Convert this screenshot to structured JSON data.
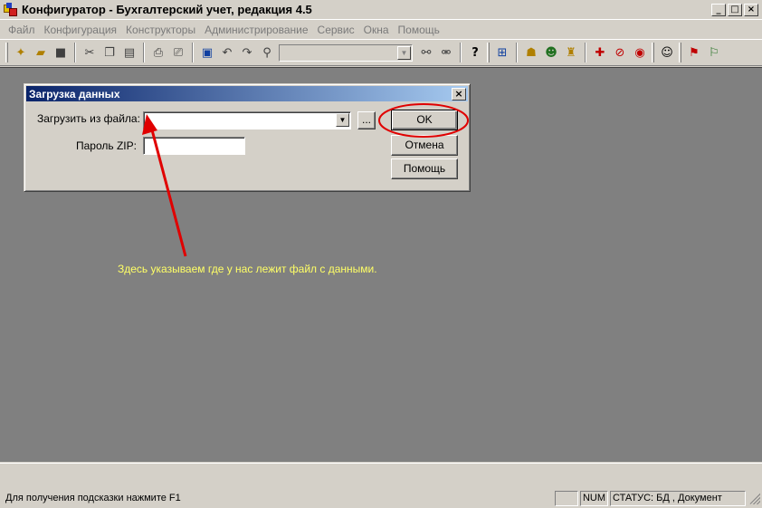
{
  "window": {
    "title": "Конфигуратор - Бухгалтерский учет, редакция 4.5",
    "minimize": "_",
    "maximize": "□",
    "close": "×"
  },
  "menu": {
    "items": [
      "Файл",
      "Конфигурация",
      "Конструкторы",
      "Администрирование",
      "Сервис",
      "Окна",
      "Помощь"
    ]
  },
  "toolbar": {
    "combo_value": "",
    "combo_arrow": "▼",
    "help_glyph": "?"
  },
  "dialog": {
    "title": "Загрузка данных",
    "close": "×",
    "file_label": "Загрузить из файла:",
    "file_value": "",
    "file_arrow": "▼",
    "browse": "...",
    "zip_label": "Пароль ZIP:",
    "zip_value": "",
    "ok": "OK",
    "cancel": "Отмена",
    "help": "Помощь"
  },
  "annotation": {
    "text": "Здесь указываем где у нас лежит файл с данными.",
    "color": "#e00000",
    "text_color": "#ffff66"
  },
  "status": {
    "hint": "Для получения подсказки нажмите F1",
    "pane_empty": "",
    "num": "NUM",
    "info": "СТАТУС: БД , Документ"
  }
}
